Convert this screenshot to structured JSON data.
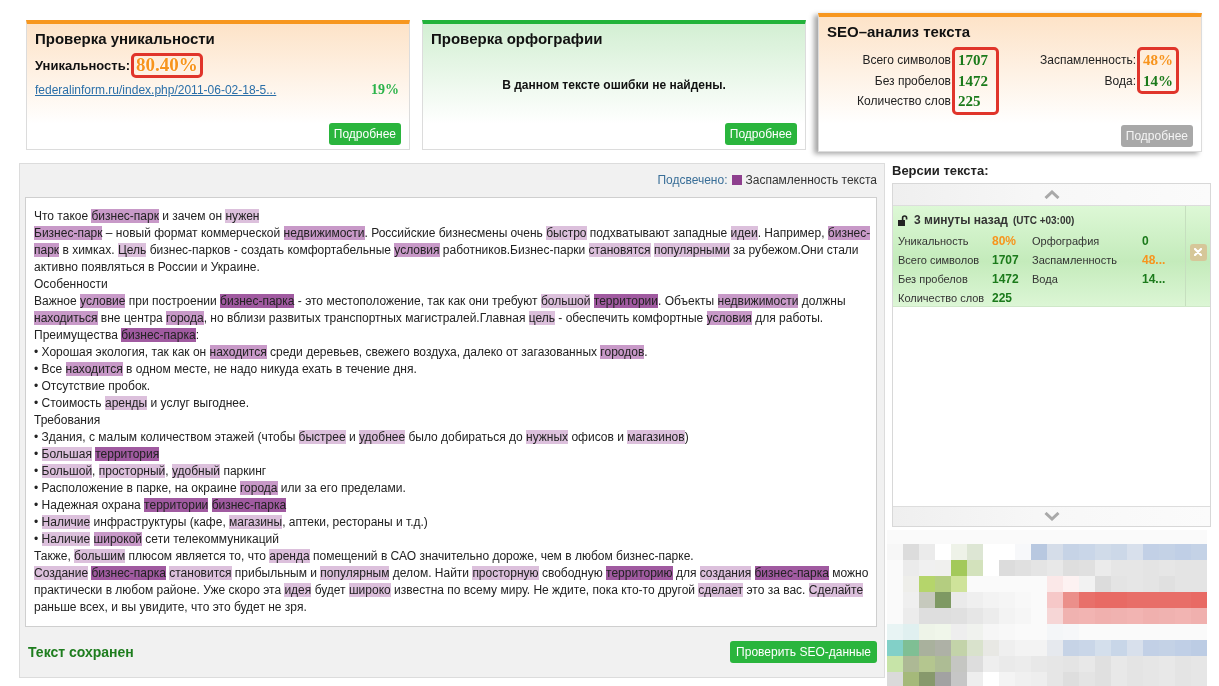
{
  "cards": [
    {
      "kind": "uniqueness",
      "title": "Проверка уникальности",
      "selected": false,
      "uniqueness": {
        "label": "Уникальность:",
        "value": "80.40%",
        "color": "#f7941d",
        "framed": true
      },
      "sources": [
        {
          "url": "federalinform.ru/index.php/2011-06-02-18-5...",
          "match": "19%",
          "color": "#2bb34a"
        }
      ],
      "button": {
        "label": "Подробнее",
        "disabled": false
      }
    },
    {
      "kind": "spelling",
      "title": "Проверка орфографии",
      "selected": false,
      "message": "В данном тексте ошибки не найдены.",
      "button": {
        "label": "Подробнее",
        "disabled": false
      }
    },
    {
      "kind": "seo",
      "title": "SEO–анализ текста",
      "selected": true,
      "columns": [
        {
          "framed": true,
          "stats": [
            {
              "label": "Всего символов",
              "value": "1707",
              "color": "#1b7a1b"
            },
            {
              "label": "Без пробелов",
              "value": "1472",
              "color": "#1b7a1b"
            },
            {
              "label": "Количество слов",
              "value": "225",
              "color": "#1b7a1b"
            }
          ]
        },
        {
          "framed": true,
          "stats": [
            {
              "label": "Заспамленность:",
              "value": "48%",
              "color": "#f7941d"
            },
            {
              "label": "Вода:",
              "value": "14%",
              "color": "#1b7a1b"
            }
          ]
        }
      ],
      "button": {
        "label": "Подробнее",
        "disabled": true
      }
    }
  ],
  "editor": {
    "legend": {
      "label": "Подсвечено:",
      "text": "Заспамленность текста",
      "color": "#8e3f8e"
    },
    "lines": [
      [
        "Что такое ",
        {
          "text": "бизнес-парк",
          "color": "#c899c8"
        },
        " и зачем он ",
        {
          "text": "нужен",
          "color": "#dcc0dc"
        }
      ],
      [
        {
          "text": "Бизнес-парк",
          "color": "#c899c8"
        },
        " – новый формат коммерческой ",
        {
          "text": "недвижимости",
          "color": "#c899c8"
        },
        ". Российские бизнесмены очень ",
        {
          "text": "быстро",
          "color": "#dcc0dc"
        },
        " подхватывают западные ",
        {
          "text": "идеи",
          "color": "#dcc0dc"
        },
        ". Например, ",
        {
          "text": "бизнес-",
          "color": "#c899c8"
        }
      ],
      [
        {
          "text": "парк",
          "color": "#c899c8"
        },
        " в химках. ",
        {
          "text": "Цель",
          "color": "#dcc0dc"
        },
        " бизнес-парков - создать комфортабельные ",
        {
          "text": "условия",
          "color": "#c899c8"
        },
        " работников.Бизнес-парки ",
        {
          "text": "становятся ",
          "color": "#dcc0dc"
        },
        {
          "text": "популярными",
          "color": "#dcc0dc"
        },
        " за рубежом.Они стали"
      ],
      [
        "активно появляться в России и Украине."
      ],
      [
        "Особенности"
      ],
      [
        "Важное ",
        {
          "text": "условие",
          "color": "#c899c8"
        },
        " при построении ",
        {
          "text": "бизнес-парка",
          "color": "#a05aa0"
        },
        " - это местоположение, так как они требуют ",
        {
          "text": "большой ",
          "color": "#dcc0dc"
        },
        {
          "text": "территории",
          "color": "#a05aa0"
        },
        ". Объекты ",
        {
          "text": "недвижимости",
          "color": "#c899c8"
        },
        " должны"
      ],
      [
        {
          "text": "находиться",
          "color": "#c899c8"
        },
        " вне центра ",
        {
          "text": "города",
          "color": "#c899c8"
        },
        ", но вблизи развитых транспортных магистралей.Главная ",
        {
          "text": "цель",
          "color": "#dcc0dc"
        },
        " - обеспечить комфортные ",
        {
          "text": "условия",
          "color": "#c899c8"
        },
        " для работы."
      ],
      [
        "Преимущества ",
        {
          "text": "бизнес-парка",
          "color": "#a05aa0"
        },
        ":"
      ],
      [
        "• Хорошая экология, так как он ",
        {
          "text": "находится",
          "color": "#c899c8"
        },
        " среди деревьев, свежего воздуха, далеко от загазованных ",
        {
          "text": "городов",
          "color": "#c899c8"
        },
        "."
      ],
      [
        "• Все ",
        {
          "text": "находится",
          "color": "#c899c8"
        },
        " в одном месте, не надо никуда ехать в течение дня."
      ],
      [
        "• Отсутствие пробок."
      ],
      [
        "• Стоимость ",
        {
          "text": "аренды",
          "color": "#dcc0dc"
        },
        " и услуг выгоднее."
      ],
      [
        "Требования"
      ],
      [
        "• Здания, с малым количеством этажей (чтобы ",
        {
          "text": "быстрее",
          "color": "#dcc0dc"
        },
        " и ",
        {
          "text": "удобнее",
          "color": "#dcc0dc"
        },
        " было добираться до ",
        {
          "text": "нужных",
          "color": "#dcc0dc"
        },
        " офисов и ",
        {
          "text": "магазинов",
          "color": "#dcc0dc"
        },
        ")"
      ],
      [
        "• ",
        {
          "text": "Большая ",
          "color": "#dcc0dc"
        },
        {
          "text": "территория",
          "color": "#a05aa0"
        }
      ],
      [
        "• ",
        {
          "text": "Большой",
          "color": "#dcc0dc"
        },
        ", ",
        {
          "text": "просторный",
          "color": "#dcc0dc"
        },
        ", ",
        {
          "text": "удобный",
          "color": "#dcc0dc"
        },
        " паркинг"
      ],
      [
        "• Расположение в парке, на окраине ",
        {
          "text": "города",
          "color": "#c899c8"
        },
        " или за его пределами."
      ],
      [
        "• Надежная охрана ",
        {
          "text": "территории ",
          "color": "#a05aa0"
        },
        {
          "text": "бизнес-парка",
          "color": "#a05aa0"
        }
      ],
      [
        "• ",
        {
          "text": "Наличие",
          "color": "#dcc0dc"
        },
        " инфраструктуры (кафе, ",
        {
          "text": "магазины",
          "color": "#dcc0dc"
        },
        ", аптеки, рестораны и т.д.)"
      ],
      [
        "• ",
        {
          "text": "Наличие ",
          "color": "#dcc0dc"
        },
        {
          "text": "широкой",
          "color": "#c899c8"
        },
        " сети телекоммуникаций"
      ],
      [
        "Также, ",
        {
          "text": "большим",
          "color": "#dcc0dc"
        },
        " плюсом является то, что ",
        {
          "text": "аренда",
          "color": "#dcc0dc"
        },
        " помещений в САО значительно дороже, чем в любом бизнес-парке."
      ],
      [
        {
          "text": "Создание ",
          "color": "#dcc0dc"
        },
        {
          "text": "бизнес-парка ",
          "color": "#a05aa0"
        },
        {
          "text": "становится",
          "color": "#dcc0dc"
        },
        " прибыльным и ",
        {
          "text": "популярным",
          "color": "#dcc0dc"
        },
        " делом. Найти ",
        {
          "text": "просторную",
          "color": "#dcc0dc"
        },
        " свободную ",
        {
          "text": "территорию",
          "color": "#a05aa0"
        },
        " для ",
        {
          "text": "создания ",
          "color": "#dcc0dc"
        },
        {
          "text": "бизнес-парка",
          "color": "#a05aa0"
        },
        " можно"
      ],
      [
        "практически в любом районе. Уже скоро эта ",
        {
          "text": "идея",
          "color": "#dcc0dc"
        },
        " будет ",
        {
          "text": "широко",
          "color": "#dcc0dc"
        },
        " известна по всему миру. Не ждите, пока кто-то другой ",
        {
          "text": "сделает",
          "color": "#dcc0dc"
        },
        " это за вас. ",
        {
          "text": "Сделайте",
          "color": "#dcc0dc"
        }
      ],
      [
        "раньше всех, и вы увидите, что это будет не зря."
      ]
    ],
    "status": "Текст сохранен",
    "button": "Проверить SEO-данные"
  },
  "versions": {
    "title": "Версии текста:",
    "items": [
      {
        "time": "3 минуты назад",
        "timezone": "(UTC +03:00)",
        "locked": false,
        "stats": [
          {
            "label": "Уникальность",
            "value": "80%",
            "color": "#f7941d"
          },
          {
            "label": "Орфография",
            "value": "0",
            "color": "#1b7a1b"
          },
          {
            "label": "Всего символов",
            "value": "1707",
            "color": "#1b7a1b"
          },
          {
            "label": "Заспамленность",
            "value": "48...",
            "color": "#f7941d"
          },
          {
            "label": "Без пробелов",
            "value": "1472",
            "color": "#1b7a1b"
          },
          {
            "label": "Вода",
            "value": "14...",
            "color": "#1b7a1b"
          },
          {
            "label": "Количество слов",
            "value": "225",
            "color": "#1b7a1b"
          }
        ]
      }
    ]
  }
}
